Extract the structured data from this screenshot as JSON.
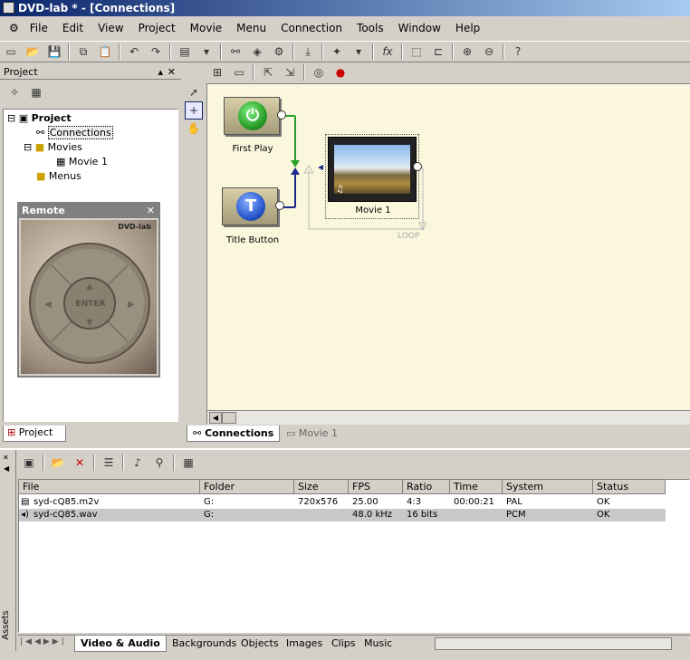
{
  "window": {
    "title": "DVD-lab * - [Connections]"
  },
  "menu": [
    "File",
    "Edit",
    "View",
    "Project",
    "Movie",
    "Menu",
    "Connection",
    "Tools",
    "Window",
    "Help"
  ],
  "project_panel": {
    "title": "Project",
    "tree": {
      "root": "Project",
      "connections": "Connections",
      "movies": "Movies",
      "movie1": "Movie 1",
      "menus": "Menus"
    },
    "tab_label": "Project"
  },
  "remote": {
    "title": "Remote",
    "logo": "DVD-lab",
    "enter": "ENTER"
  },
  "canvas": {
    "first_play": "First Play",
    "title_button": "Title Button",
    "movie": "Movie 1",
    "loop": "LOOP"
  },
  "editor_tabs": {
    "connections": "Connections",
    "movie1": "Movie 1"
  },
  "assets": {
    "side_label": "Assets",
    "columns": [
      "File",
      "Folder",
      "Size",
      "FPS",
      "Ratio",
      "Time",
      "System",
      "Status"
    ],
    "rows": [
      {
        "file": "syd-cQ85.m2v",
        "folder": "G:",
        "size": "720x576",
        "fps": "25.00",
        "ratio": "4:3",
        "time": "00:00:21",
        "system": "PAL",
        "status": "OK"
      },
      {
        "file": "syd-cQ85.wav",
        "folder": "G:",
        "size": "",
        "fps": "48.0 kHz",
        "ratio": "16 bits",
        "time": "",
        "system": "PCM",
        "status": "OK"
      }
    ],
    "tabs": [
      "Video & Audio",
      "Backgrounds",
      "Objects",
      "Images",
      "Clips",
      "Music"
    ]
  },
  "colors": {
    "title_bar": "#0a246a",
    "canvas_bg": "#fbf7dc",
    "selected_row": "#c8c8c8",
    "power_button": "#2aa02a",
    "title_btn": "#2a5ad0"
  },
  "icons": [
    "new-icon",
    "open-icon",
    "save-icon",
    "copy-icon",
    "paste-icon",
    "undo-icon",
    "redo-icon",
    "layout-icon",
    "connect-icon",
    "burn-icon",
    "wizard-icon",
    "fx-icon",
    "zoom-in-icon",
    "zoom-out-icon",
    "help-icon"
  ]
}
